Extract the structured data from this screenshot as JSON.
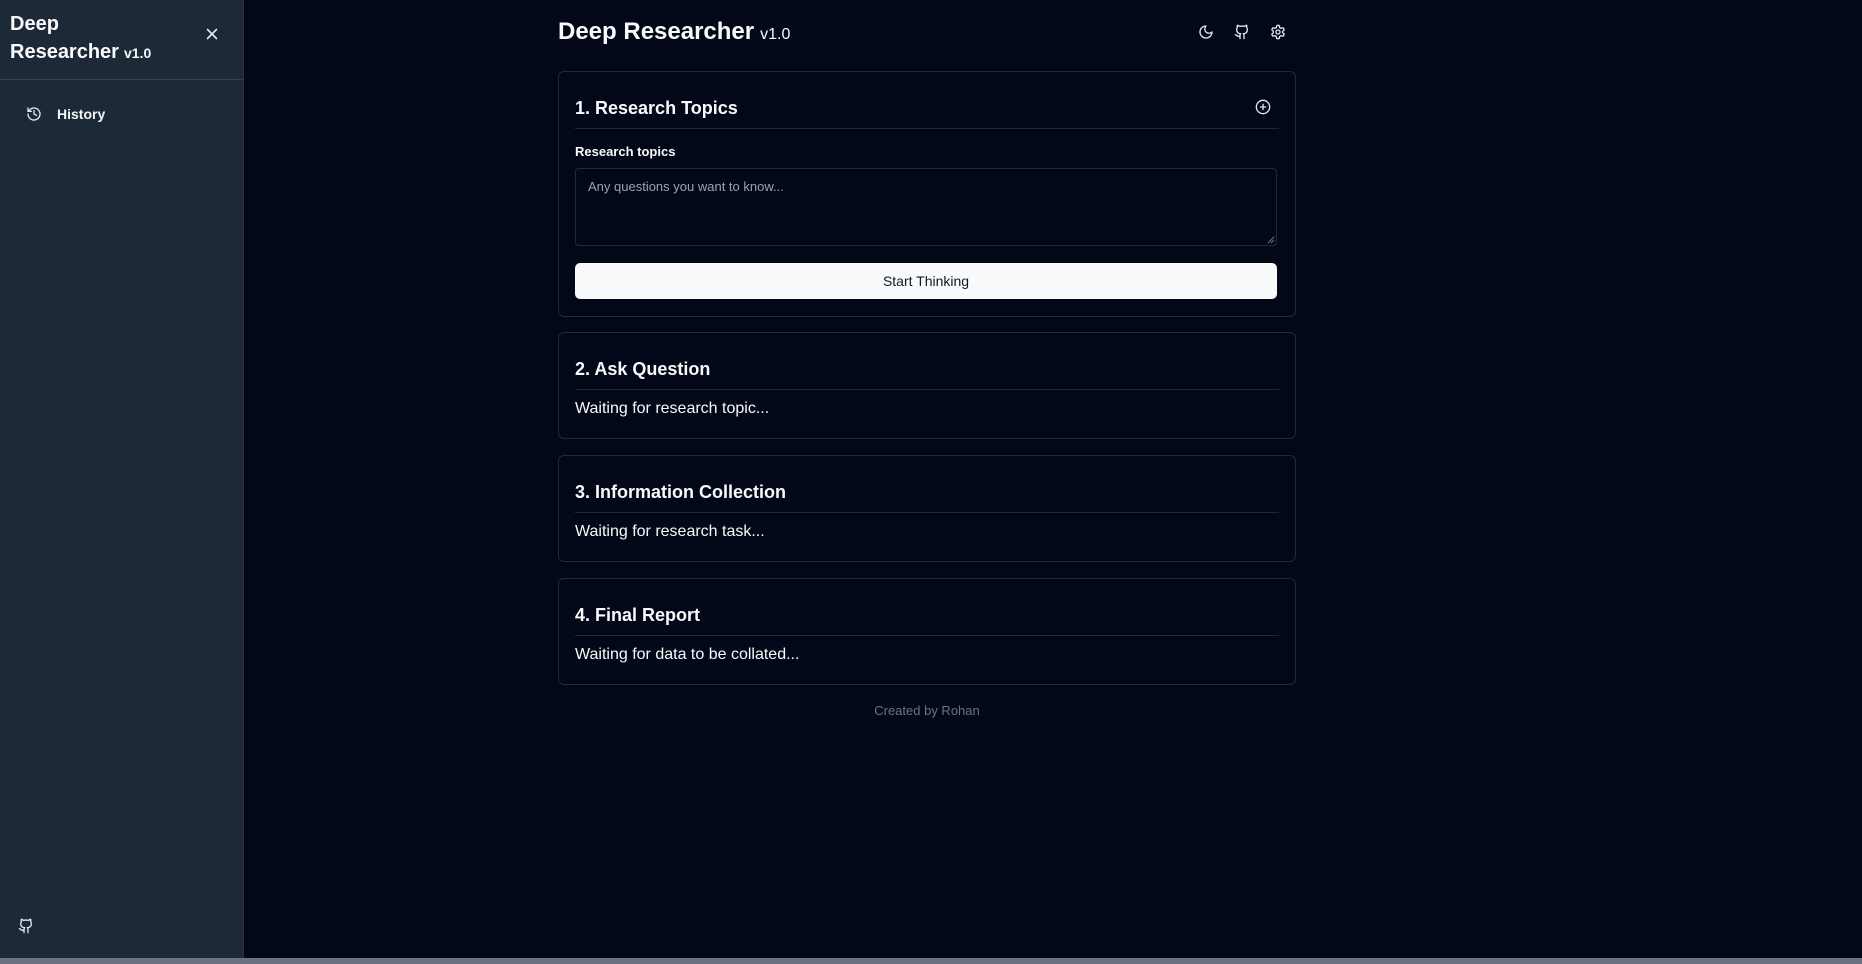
{
  "sidebar": {
    "title": "Deep Researcher",
    "version": "v1.0",
    "items": [
      {
        "label": "History",
        "icon": "history-icon"
      }
    ],
    "footer_icon": "github-icon"
  },
  "header": {
    "title": "Deep Researcher",
    "version": "v1.0",
    "icons": [
      "moon-icon",
      "github-icon",
      "gear-icon"
    ]
  },
  "cards": {
    "research": {
      "title": "1. Research Topics",
      "field_label": "Research topics",
      "placeholder": "Any questions you want to know...",
      "value": "",
      "button_label": "Start Thinking"
    },
    "ask": {
      "title": "2. Ask Question",
      "status": "Waiting for research topic..."
    },
    "collect": {
      "title": "3. Information Collection",
      "status": "Waiting for research task..."
    },
    "report": {
      "title": "4. Final Report",
      "status": "Waiting for data to be collated..."
    }
  },
  "footer": {
    "text": "Created by Rohan"
  },
  "colors": {
    "background": "#020817",
    "sidebar": "#1e2937",
    "border": "#1e293b",
    "button": "#f8fafc"
  }
}
